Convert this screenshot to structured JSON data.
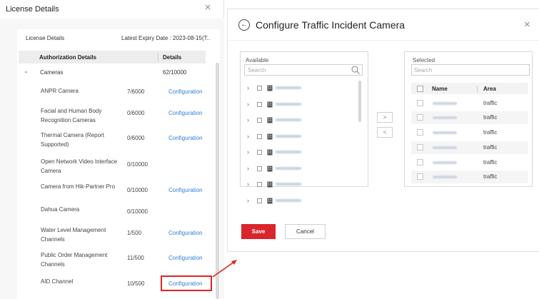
{
  "left_panel": {
    "title": "License Details",
    "license_label": "License Details",
    "expiry": "Latest Expiry Date : 2023-08-15(T..",
    "columns": {
      "auth": "Authorization Details",
      "details": "Details"
    },
    "group": {
      "name": "Cameras",
      "count": "62/10000"
    },
    "rows": [
      {
        "name": "ANPR Camera",
        "count": "7/6000",
        "config": "Configuration"
      },
      {
        "name": "Facial and Human Body Recognition Cameras",
        "count": "0/6000",
        "config": "Configuration"
      },
      {
        "name": "Thermal Camera (Report Supported)",
        "count": "0/6000",
        "config": "Configuration"
      },
      {
        "name": "Open Network Video Interface Camera",
        "count": "0/10000",
        "config": ""
      },
      {
        "name": "Camera from Hik-Partner Pro",
        "count": "0/10000",
        "config": "Configuration"
      },
      {
        "name": "Dahua Camera",
        "count": "0/10000",
        "config": ""
      },
      {
        "name": "Water Level Management Channels",
        "count": "1/500",
        "config": "Configuration"
      },
      {
        "name": "Public Order Management Channels",
        "count": "11/500",
        "config": "Configuration"
      },
      {
        "name": "AID Channel",
        "count": "10/500",
        "config": "Configuration"
      }
    ]
  },
  "dialog": {
    "title": "Configure Traffic Incident Camera",
    "available": {
      "label": "Available",
      "search_placeholder": "Search",
      "tree_count": 8
    },
    "move_right": ">",
    "move_left": "<",
    "selected": {
      "label": "Selected",
      "search_placeholder": "Search",
      "columns": {
        "name": "Name",
        "area": "Area"
      },
      "rows": [
        {
          "area": "traffic"
        },
        {
          "area": "traffic"
        },
        {
          "area": "traffic"
        },
        {
          "area": "traffic"
        },
        {
          "area": "traffic"
        },
        {
          "area": "traffic"
        }
      ]
    },
    "save_label": "Save",
    "cancel_label": "Cancel"
  },
  "colors": {
    "accent_red": "#d9252b",
    "link_blue": "#2f7fd6",
    "highlight_red": "#e02424"
  }
}
